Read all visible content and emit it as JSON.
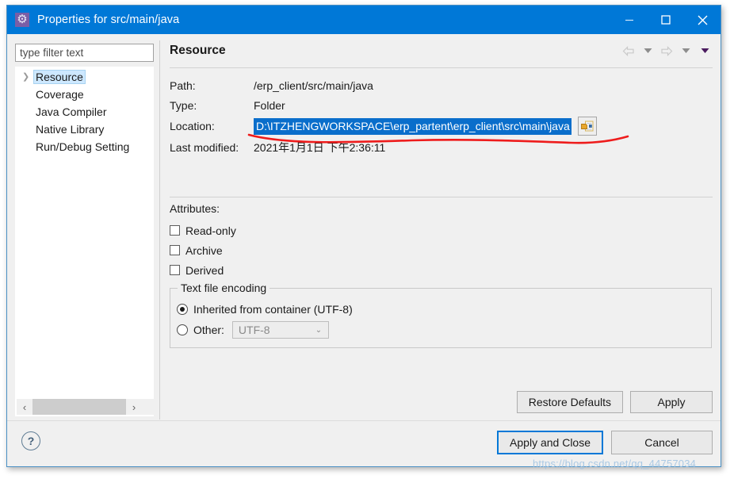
{
  "window": {
    "title": "Properties for src/main/java",
    "icon": "gear-icon",
    "minimize_label": "—",
    "maximize_label": "□",
    "close_label": "✕",
    "accent_color": "#0078d7"
  },
  "sidebar": {
    "filter_placeholder": "type filter text",
    "filter_value": "",
    "items": [
      {
        "label": "Resource",
        "expandable": true,
        "selected": true
      },
      {
        "label": "Coverage",
        "expandable": false,
        "selected": false
      },
      {
        "label": "Java Compiler",
        "expandable": false,
        "selected": false
      },
      {
        "label": "Native Library",
        "expandable": false,
        "selected": false
      },
      {
        "label": "Run/Debug Setting",
        "expandable": false,
        "selected": false
      }
    ],
    "scroll_left_label": "‹",
    "scroll_right_label": "›"
  },
  "page": {
    "title": "Resource",
    "nav": {
      "back": "back-arrow-icon",
      "back_menu": "chevron-down-icon",
      "forward": "forward-arrow-icon",
      "forward_menu": "chevron-down-icon",
      "view_menu": "chevron-down-filled-icon"
    },
    "fields": [
      {
        "label": "Path:",
        "value": "/erp_client/src/main/java",
        "highlight": false
      },
      {
        "label": "Type:",
        "value": "Folder",
        "highlight": false
      },
      {
        "label": "Location:",
        "value": "D:\\ITZHENGWORKSPACE\\erp_partent\\erp_client\\src\\main\\java",
        "highlight": true
      },
      {
        "label": "Last modified:",
        "value": "2021年1月1日 下午2:36:11",
        "highlight": false
      }
    ],
    "location_button": "edit-location-icon",
    "attributes_title": "Attributes:",
    "attributes": [
      {
        "label": "Read-only",
        "checked": false
      },
      {
        "label": "Archive",
        "checked": false
      },
      {
        "label": "Derived",
        "checked": false
      }
    ],
    "encoding": {
      "legend": "Text file encoding",
      "inherited_label": "Inherited from container (UTF-8)",
      "inherited_selected": true,
      "other_label": "Other:",
      "other_selected": false,
      "other_value": "UTF-8",
      "caret": "⌄"
    },
    "buttons": {
      "restore_defaults": "Restore Defaults",
      "apply": "Apply"
    }
  },
  "footer": {
    "help_label": "?",
    "apply_and_close": "Apply and Close",
    "cancel": "Cancel"
  },
  "annotation": {
    "color": "#ee1c1c",
    "type": "hand-drawn-underline"
  },
  "watermark": {
    "text": "https://blog.csdn.net/qq_44757034"
  }
}
